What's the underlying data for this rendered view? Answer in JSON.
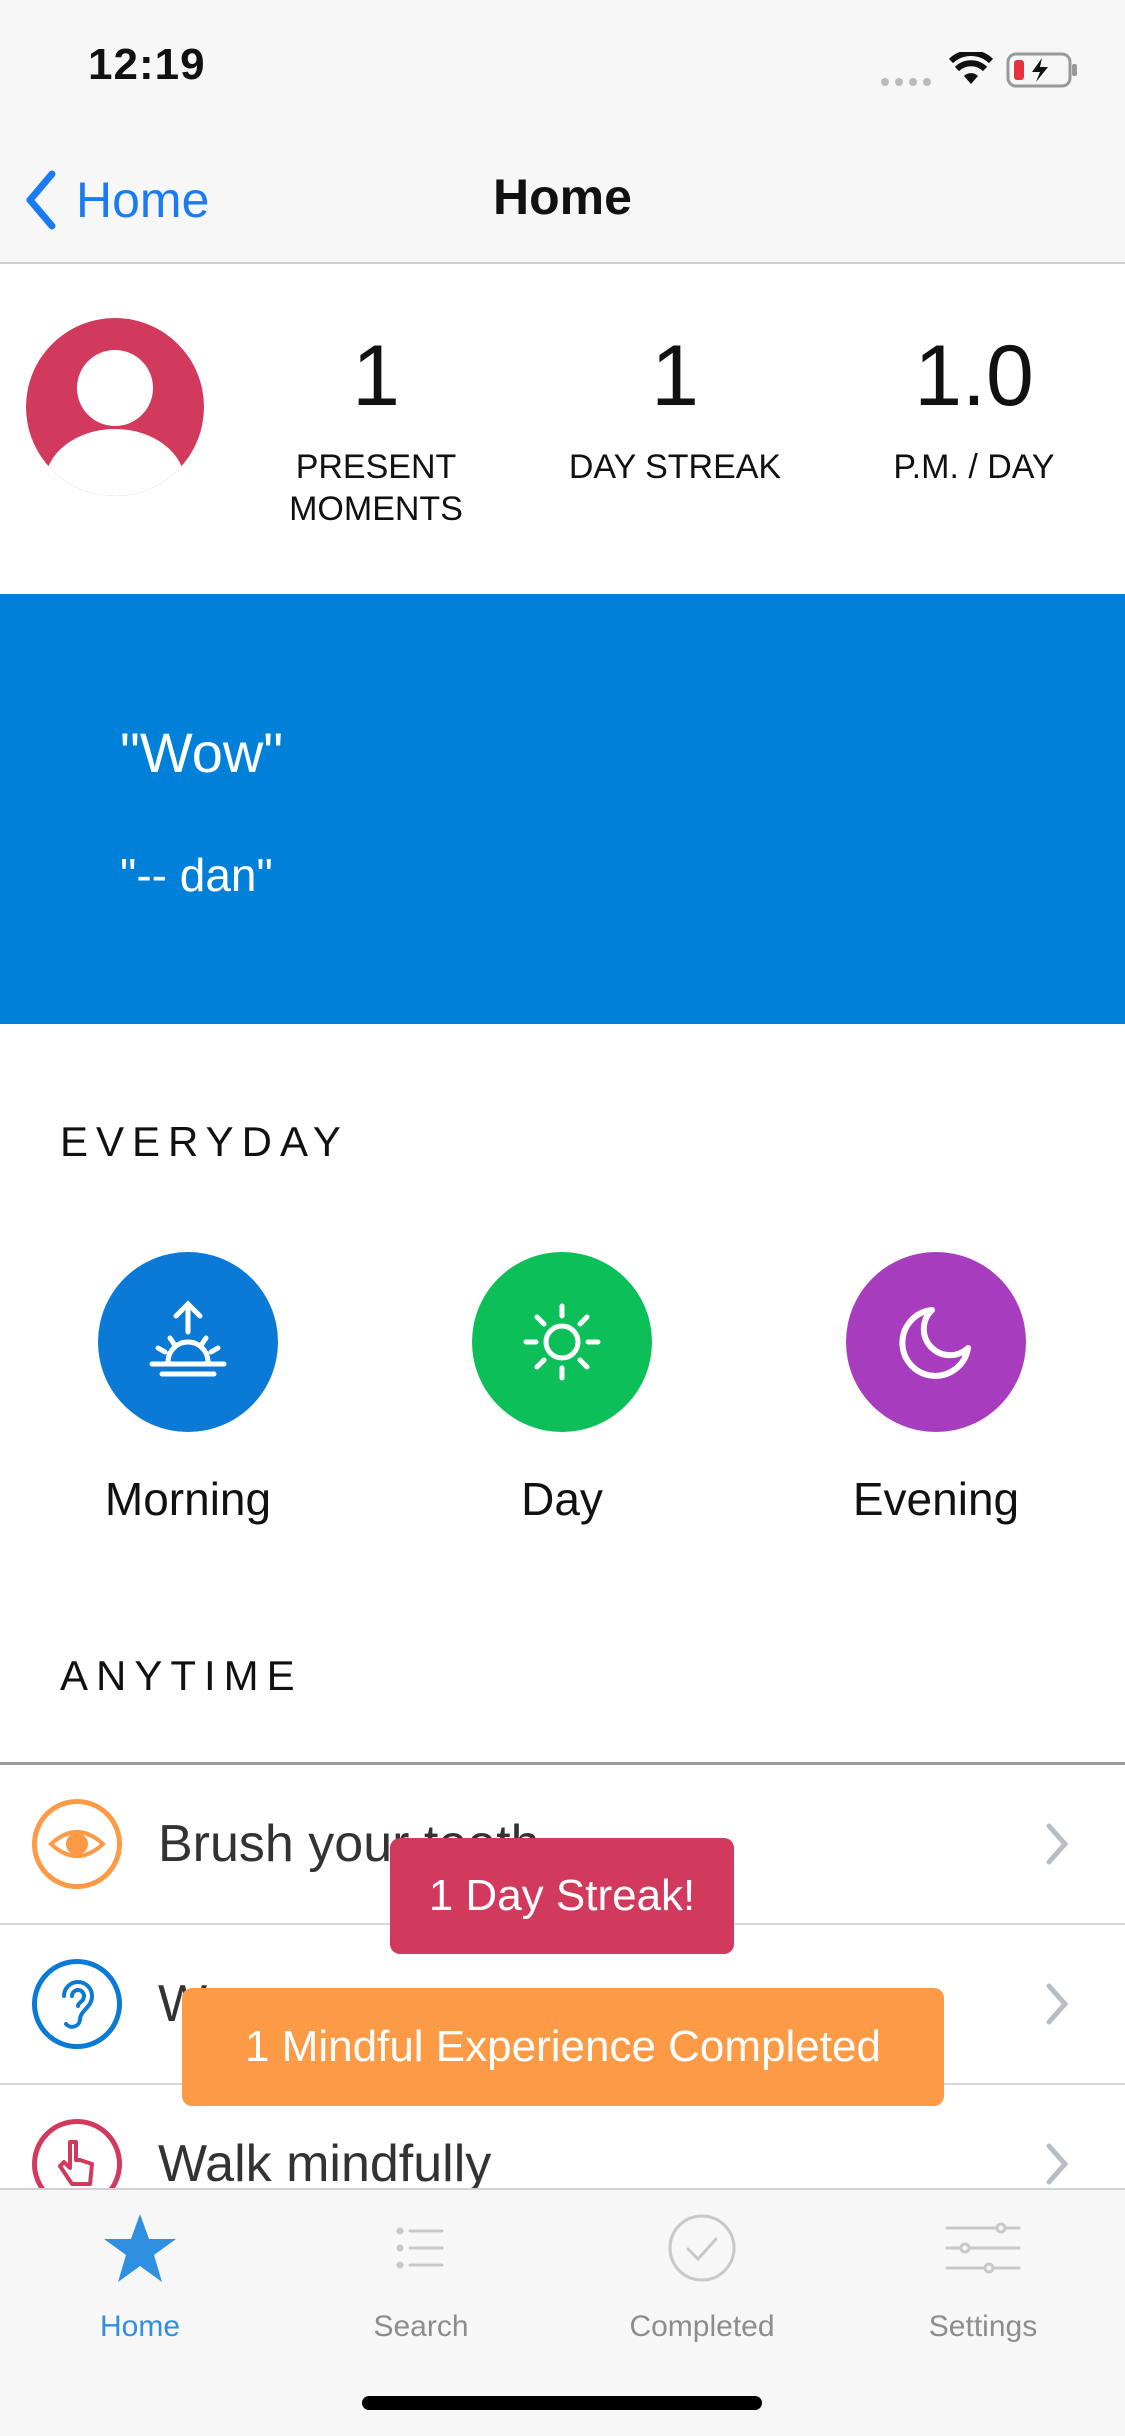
{
  "status_bar": {
    "time": "12:19"
  },
  "nav": {
    "back_label": "Home",
    "title": "Home"
  },
  "stats": [
    {
      "value": "1",
      "label_line1": "PRESENT",
      "label_line2": "MOMENTS"
    },
    {
      "value": "1",
      "label_line1": "DAY STREAK",
      "label_line2": ""
    },
    {
      "value": "1.0",
      "label_line1": "P.M. / DAY",
      "label_line2": ""
    }
  ],
  "quote": {
    "text": "\"Wow\"",
    "author": "\"-- dan\""
  },
  "everyday": {
    "title": "EVERYDAY",
    "items": [
      {
        "label": "Morning",
        "icon": "sunrise-icon",
        "color": "#0a7ad6"
      },
      {
        "label": "Day",
        "icon": "sun-icon",
        "color": "#0cbf58"
      },
      {
        "label": "Evening",
        "icon": "moon-icon",
        "color": "#a83cbf"
      }
    ]
  },
  "anytime": {
    "title": "ANYTIME",
    "items": [
      {
        "label": "Brush your teeth",
        "icon": "eye-icon",
        "color": "#fd9a46"
      },
      {
        "label": "W",
        "icon": "ear-icon",
        "color": "#0a7ad6"
      },
      {
        "label": "Walk mindfully",
        "icon": "hand-icon",
        "color": "#d23a5d"
      }
    ]
  },
  "toasts": {
    "streak": "1 Day Streak!",
    "mindful": "1 Mindful Experience Completed"
  },
  "tabs": [
    {
      "label": "Home",
      "icon": "star-icon",
      "active": true
    },
    {
      "label": "Search",
      "icon": "list-icon",
      "active": false
    },
    {
      "label": "Completed",
      "icon": "checkmark-circle-icon",
      "active": false
    },
    {
      "label": "Settings",
      "icon": "sliders-icon",
      "active": false
    }
  ],
  "colors": {
    "accent": "#1a7cf0",
    "banner": "#0080d8",
    "streak_toast": "#d23a5d",
    "mindful_toast": "#fd9a46"
  }
}
